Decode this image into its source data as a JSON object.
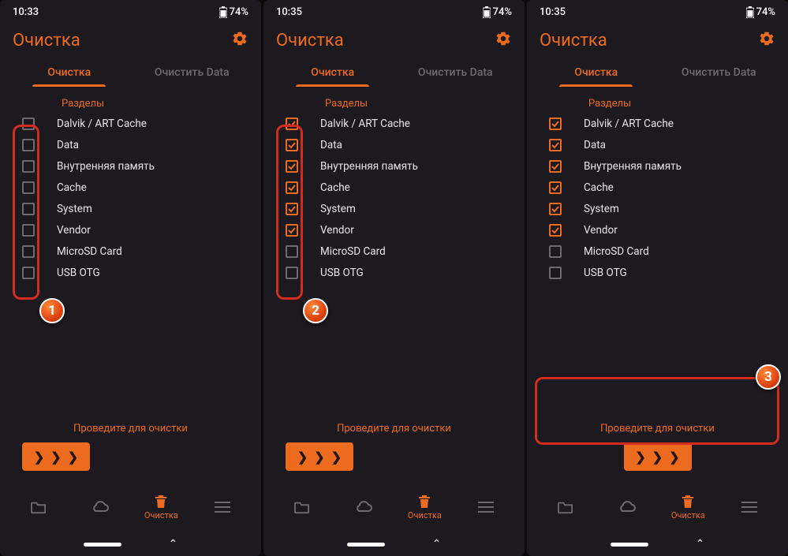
{
  "status": {
    "battery": "74%"
  },
  "header": {
    "title": "Очистка"
  },
  "tabs": {
    "clean": "Очистка",
    "clean_data": "Очистить Data"
  },
  "section_label": "Разделы",
  "partitions": [
    {
      "label": "Dalvik / ART Cache"
    },
    {
      "label": "Data"
    },
    {
      "label": "Внутренняя память"
    },
    {
      "label": "Cache"
    },
    {
      "label": "System"
    },
    {
      "label": "Vendor"
    },
    {
      "label": "MicroSD Card"
    },
    {
      "label": "USB OTG"
    }
  ],
  "swipe_hint": "Проведите для очистки",
  "nav": {
    "clean": "Очистка"
  },
  "screens": [
    {
      "time": "10:33",
      "checked": [
        false,
        false,
        false,
        false,
        false,
        false,
        false,
        false
      ],
      "badge": "1",
      "highlight": "checkboxes",
      "swipe_align": "left"
    },
    {
      "time": "10:35",
      "checked": [
        true,
        true,
        true,
        true,
        true,
        true,
        false,
        false
      ],
      "badge": "2",
      "highlight": "checkboxes",
      "swipe_align": "left"
    },
    {
      "time": "10:35",
      "checked": [
        true,
        true,
        true,
        true,
        true,
        true,
        false,
        false
      ],
      "badge": "3",
      "highlight": "swipe",
      "swipe_align": "center"
    }
  ]
}
